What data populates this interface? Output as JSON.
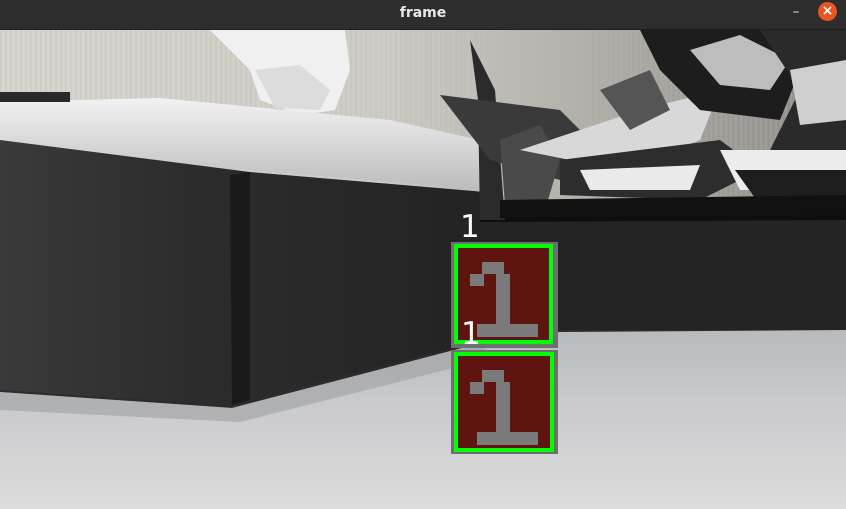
{
  "window": {
    "title": "frame",
    "minimize_symbol": "–",
    "close_symbol": "×",
    "accent_color": "#e95420"
  },
  "scene": {
    "detections": [
      {
        "label": "1",
        "box_color": "#00ff00",
        "marker_face": "1",
        "marker_color": "#5e1510"
      },
      {
        "label": "1",
        "box_color": "#00ff00",
        "marker_face": "1",
        "marker_color": "#5e1510"
      }
    ]
  }
}
